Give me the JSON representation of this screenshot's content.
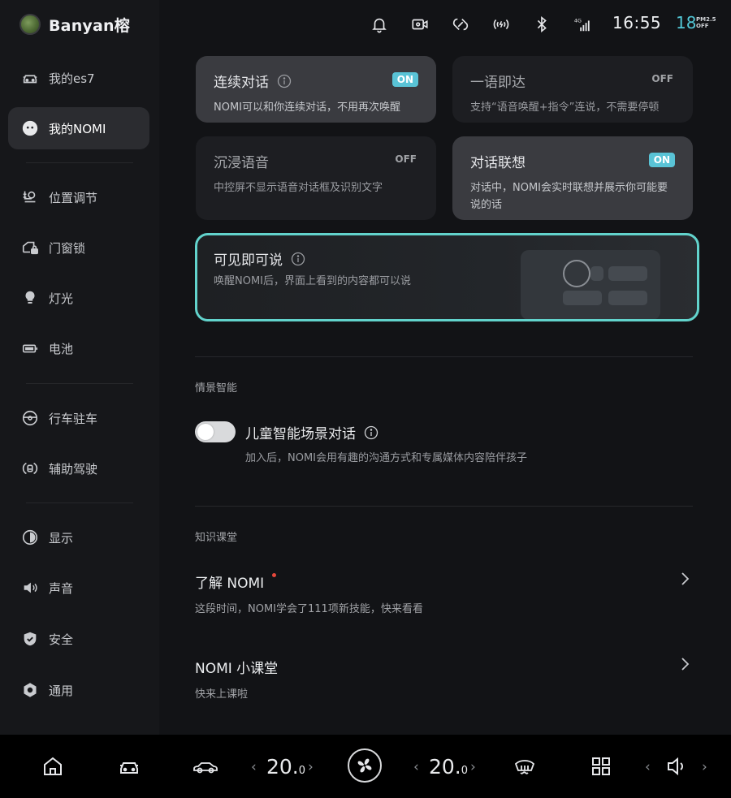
{
  "brand": {
    "name": "Banyan榕"
  },
  "status": {
    "time": "16:55",
    "pm_value": "18",
    "pm_label_top": "PM2.5",
    "pm_label_bottom": "OFF",
    "network": "4G"
  },
  "sidebar": {
    "items": [
      {
        "label": "我的es7",
        "icon": "car-icon"
      },
      {
        "label": "我的NOMI",
        "icon": "nomi-icon"
      },
      {
        "label": "位置调节",
        "icon": "seat-icon"
      },
      {
        "label": "门窗锁",
        "icon": "door-lock-icon"
      },
      {
        "label": "灯光",
        "icon": "bulb-icon"
      },
      {
        "label": "电池",
        "icon": "battery-icon"
      },
      {
        "label": "行车驻车",
        "icon": "steering-wheel-icon"
      },
      {
        "label": "辅助驾驶",
        "icon": "assisted-driving-icon"
      },
      {
        "label": "显示",
        "icon": "display-icon"
      },
      {
        "label": "声音",
        "icon": "speaker-icon"
      },
      {
        "label": "安全",
        "icon": "shield-icon"
      },
      {
        "label": "通用",
        "icon": "general-icon"
      }
    ],
    "active": "我的NOMI"
  },
  "cards": [
    {
      "title": "连续对话",
      "state": "ON",
      "desc": "NOMI可以和你连续对话，不用再次唤醒"
    },
    {
      "title": "一语即达",
      "state": "OFF",
      "desc": "支持“语音唤醒+指令”连说，不需要停顿"
    },
    {
      "title": "沉浸语音",
      "state": "OFF",
      "desc": "中控屏不显示语音对话框及识别文字"
    },
    {
      "title": "对话联想",
      "state": "ON",
      "desc": "对话中，NOMI会实时联想并展示你可能要说的话"
    }
  ],
  "highlight": {
    "title": "可见即可说",
    "desc": "唤醒NOMI后，界面上看到的内容都可以说"
  },
  "scene": {
    "section_title": "情景智能",
    "toggle_title": "儿童智能场景对话",
    "toggle_desc": "加入后，NOMI会用有趣的沟通方式和专属媒体内容陪伴孩子",
    "toggle_on": false
  },
  "knowledge": {
    "section_title": "知识课堂",
    "items": [
      {
        "title": "了解 NOMI",
        "desc": "这段时间，NOMI学会了111项新技能，快来看看",
        "dot": true
      },
      {
        "title": "NOMI 小课堂",
        "desc": "快来上课啦",
        "dot": false
      }
    ]
  },
  "dock": {
    "left_temp": "20.",
    "left_temp_dec": "0",
    "right_temp": "20.",
    "right_temp_dec": "0",
    "arrow_left": "‹",
    "arrow_right": "›"
  },
  "colors": {
    "accent": "#59c3d6",
    "highlight_border": "#62d3cc",
    "alert": "#e5473b"
  }
}
